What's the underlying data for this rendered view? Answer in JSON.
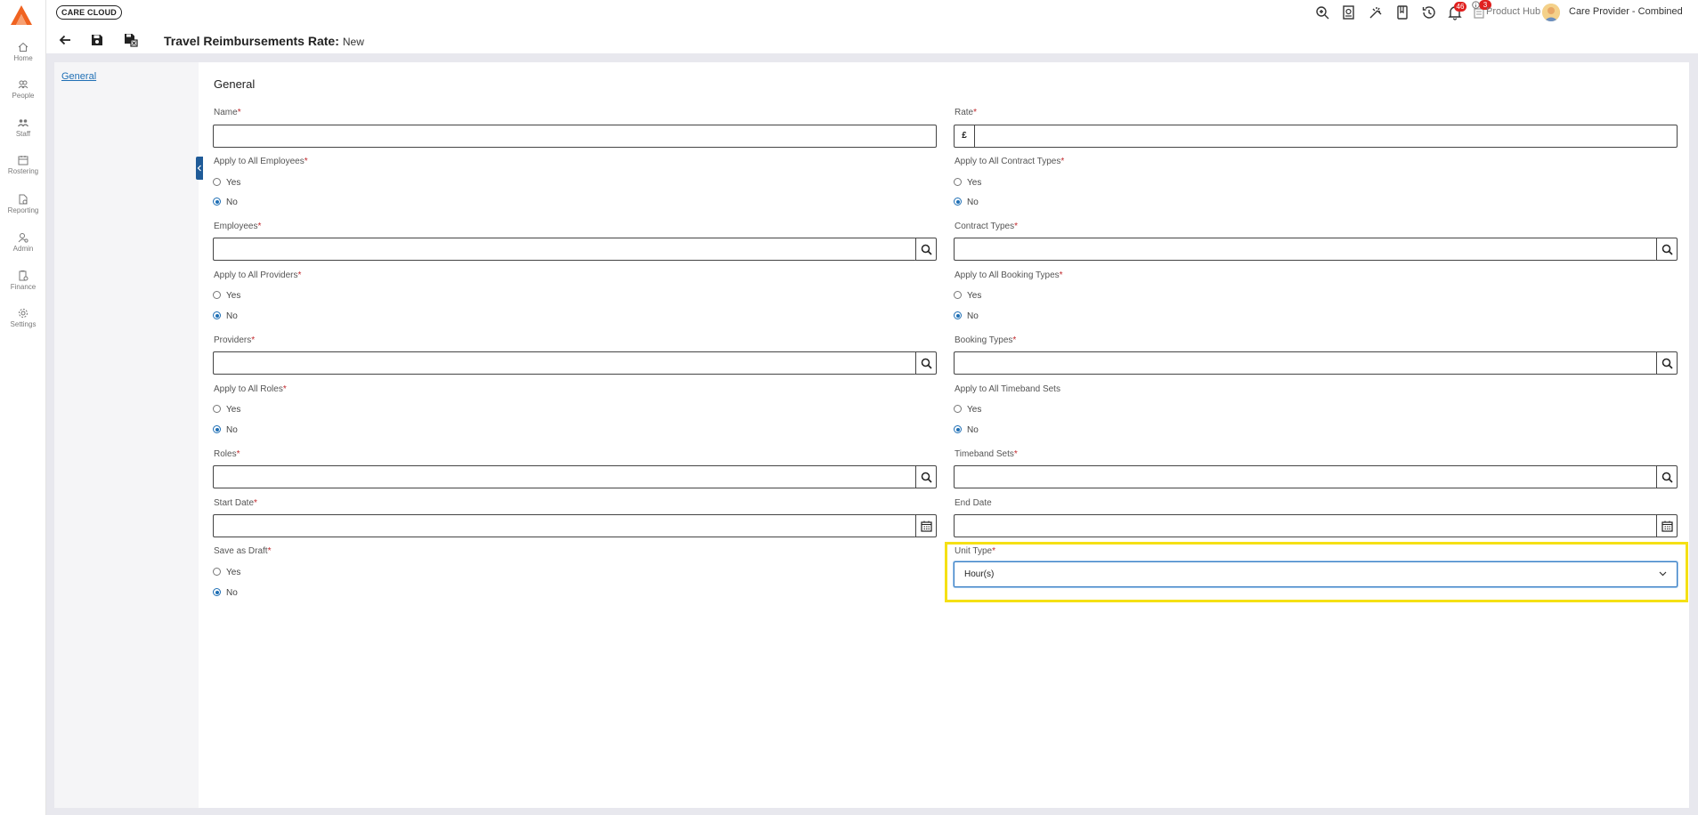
{
  "brand": {
    "name": "CARE CLOUD",
    "accent": "#f06321"
  },
  "nav": [
    {
      "label": "Home",
      "icon": "home-icon"
    },
    {
      "label": "People",
      "icon": "people-icon"
    },
    {
      "label": "Staff",
      "icon": "staff-icon"
    },
    {
      "label": "Rostering",
      "icon": "rostering-icon"
    },
    {
      "label": "Reporting",
      "icon": "reporting-icon"
    },
    {
      "label": "Admin",
      "icon": "admin-icon"
    },
    {
      "label": "Finance",
      "icon": "finance-icon"
    },
    {
      "label": "Settings",
      "icon": "settings-icon"
    }
  ],
  "topbar": {
    "notifications_count": "46",
    "product_hub_count": "3",
    "product_hub_label": "Product Hub",
    "user_name": "Care Provider - Combined"
  },
  "toolbar": {
    "title": "Travel Reimbursements Rate:",
    "status": "New"
  },
  "sidebar": {
    "link": "General"
  },
  "form": {
    "section": "General",
    "name_label": "Name",
    "rate_label": "Rate",
    "currency_symbol": "£",
    "apply_employees_label": "Apply to All Employees",
    "apply_contract_types_label": "Apply to All Contract Types",
    "employees_label": "Employees",
    "contract_types_label": "Contract Types",
    "apply_providers_label": "Apply to All Providers",
    "apply_booking_types_label": "Apply to All Booking Types",
    "providers_label": "Providers",
    "booking_types_label": "Booking Types",
    "apply_roles_label": "Apply to All Roles",
    "apply_timeband_sets_label": "Apply to All Timeband Sets",
    "roles_label": "Roles",
    "timeband_sets_label": "Timeband Sets",
    "start_date_label": "Start Date",
    "end_date_label": "End Date",
    "save_as_draft_label": "Save as Draft",
    "unit_type_label": "Unit Type",
    "unit_type_value": "Hour(s)",
    "yes": "Yes",
    "no": "No",
    "required_mark": "*"
  }
}
